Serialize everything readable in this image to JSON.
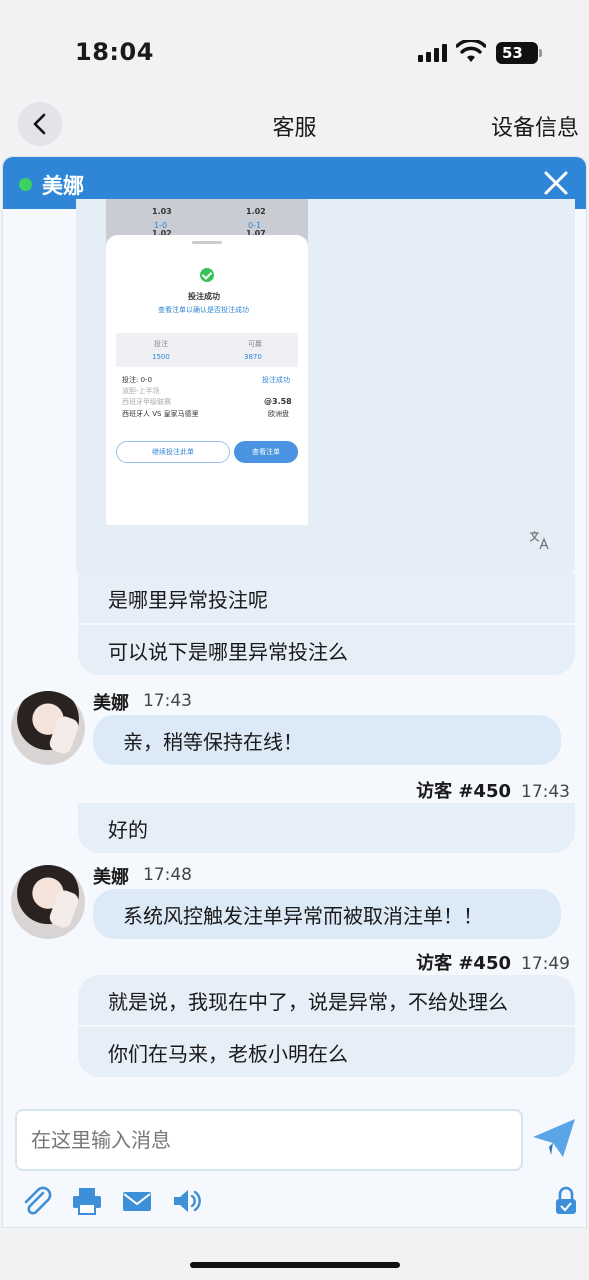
{
  "status_bar": {
    "time": "18:04",
    "battery": "53"
  },
  "nav": {
    "title": "客服",
    "right_action": "设备信息"
  },
  "chat": {
    "agent_name": "美娜",
    "screenshot": {
      "cells": [
        "1.03",
        "1.02",
        "1-0",
        "0-1",
        "1.02",
        "1.07"
      ],
      "title": "投注成功",
      "subtitle": "查看注单以确认是否投注成功",
      "col1_label": "投注",
      "col2_label": "可赢",
      "col1_value": "1500",
      "col2_value": "3870",
      "bet_line": "投注: 0-0",
      "bet_status": "投注成功",
      "market": "波胆-上半场",
      "league": "西班牙甲级联赛",
      "odds": "@3.58",
      "match": "西班牙人 VS 皇家马德里",
      "odds_type": "欧洲盘",
      "btn_continue": "继续投注此单",
      "btn_view": "查看注单"
    },
    "messages": [
      {
        "type": "visitor",
        "text": "是哪里异常投注呢"
      },
      {
        "type": "visitor",
        "text": "可以说下是哪里异常投注么"
      },
      {
        "type": "agent",
        "name": "美娜",
        "time": "17:43",
        "text": "亲，稍等保持在线！"
      },
      {
        "type": "visitor_meta",
        "name": "访客 #450",
        "time": "17:43"
      },
      {
        "type": "visitor",
        "text": "好的"
      },
      {
        "type": "agent",
        "name": "美娜",
        "time": "17:48",
        "text": "系统风控触发注单异常而被取消注单！！"
      },
      {
        "type": "visitor_meta",
        "name": "访客 #450",
        "time": "17:49"
      },
      {
        "type": "visitor",
        "text": "就是说，我现在中了，说是异常，不给处理么"
      },
      {
        "type": "visitor",
        "text": "你们在马来，老板小明在么"
      }
    ],
    "input_placeholder": "在这里输入消息"
  },
  "colors": {
    "header": "#2f86d6",
    "online": "#3dd15f",
    "agent_bubble": "#dce9f7",
    "visitor_bubble": "#e6eef7",
    "tool_icon": "#3d8fd8"
  },
  "icons": [
    "back-icon",
    "close-icon",
    "translate-icon",
    "send-icon",
    "attachment-icon",
    "print-icon",
    "mail-icon",
    "volume-icon",
    "lock-icon"
  ]
}
